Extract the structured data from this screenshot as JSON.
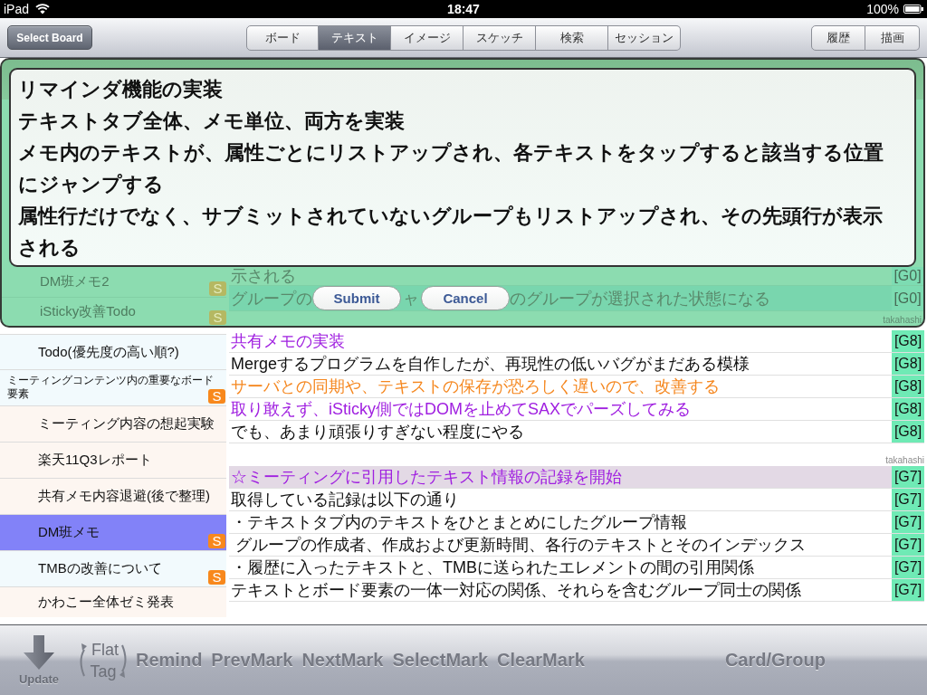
{
  "status_bar": {
    "device": "iPad",
    "time": "18:47",
    "battery": "100%"
  },
  "nav_bar": {
    "select_button": "Select Board",
    "tabs": [
      {
        "label": "ボード",
        "selected": false
      },
      {
        "label": "テキスト",
        "selected": true
      },
      {
        "label": "イメージ",
        "selected": false
      },
      {
        "label": "スケッチ",
        "selected": false
      },
      {
        "label": "検索",
        "selected": false
      },
      {
        "label": "セッション",
        "selected": false
      }
    ],
    "right_buttons": [
      "履歴",
      "描画"
    ]
  },
  "editor": {
    "paragraphs": [
      "リマインダ機能の実装",
      "テキストタブ全体、メモ単位、両方を実装",
      "メモ内のテキストが、属性ごとにリストアップされ、各テキストをタップすると該当する位置にジャンプする",
      "属性行だけでなく、サブミットされていないグループもリストアップされ、その先頭行が表示される"
    ],
    "buttons": [
      "Submit",
      "Cancel"
    ]
  },
  "dimmed_notes": [
    {
      "title": "DM班メモ2",
      "badge": "S"
    },
    {
      "title": "iSticky改善Todo",
      "badge": "S"
    }
  ],
  "dimmed_rows": [
    {
      "kind": "plain",
      "parts": [
        "示される"
      ],
      "tag": "[G0]",
      "highlighted": false
    },
    {
      "kind": "buttons",
      "parts": [
        "グループの",
        "ャ",
        "のグループが選択された状態になる"
      ],
      "tag": "[G0]",
      "highlighted": true
    }
  ],
  "notes": [
    {
      "title": "Todo(優先度の高い順?)",
      "kind": "normal",
      "color": "#f2fafd",
      "selected": false
    },
    {
      "title": "ミーティングコンテンツ内の重要なボード要素",
      "kind": "compact",
      "color": "#f2fafd",
      "badge": "S",
      "selected": false
    },
    {
      "title": "ミーティング内容の想起実験",
      "kind": "normal",
      "color": "#fdf6f1",
      "selected": false
    },
    {
      "title": "楽天11Q3レポート",
      "kind": "normal",
      "color": "#fdf6f1",
      "selected": false
    },
    {
      "title": "共有メモ内容退避(後で整理)",
      "kind": "normal",
      "color": "#fdf6f1",
      "selected": false
    },
    {
      "title": "DM班メモ",
      "kind": "normal",
      "badge": "S",
      "selected": true
    },
    {
      "title": "TMBの改善について",
      "kind": "normal",
      "color": "#f2fafd",
      "badge": "S",
      "selected": false
    },
    {
      "title": "かわこー全体ゼミ発表",
      "kind": "normal",
      "color": "#fdf6f1",
      "selected": false
    }
  ],
  "memo": {
    "groups": [
      {
        "author": "takahashi",
        "rows": [
          {
            "text": "共有メモの実装",
            "color": "#a020e0",
            "tag": "[G8]",
            "marked": false
          },
          {
            "text": "Mergeするプログラムを自作したが、再現性の低いバグがまだある模様",
            "color": "#111111",
            "tag": "[G8]",
            "marked": false
          },
          {
            "text": "サーバとの同期や、テキストの保存が恐ろしく遅いので、改善する",
            "color": "#f5871f",
            "tag": "[G8]",
            "marked": false
          },
          {
            "text": "取り敢えず、iSticky側ではDOMを止めてSAXでパーズしてみる",
            "color": "#a020e0",
            "tag": "[G8]",
            "marked": false
          },
          {
            "text": "でも、あまり頑張りすぎない程度にやる",
            "color": "#111111",
            "tag": "[G8]",
            "marked": false
          }
        ]
      },
      {
        "author": "takahashi",
        "rows": [
          {
            "text": "☆ミーティングに引用したテキスト情報の記録を開始",
            "color": "#a020e0",
            "tag": "[G7]",
            "marked": true
          },
          {
            "text": "取得している記録は以下の通り",
            "color": "#111111",
            "tag": "[G7]",
            "marked": false
          },
          {
            "text": "・テキストタブ内のテキストをひとまとめにしたグループ情報",
            "color": "#111111",
            "tag": "[G7]",
            "marked": false
          },
          {
            "text": " グループの作成者、作成および更新時間、各行のテキストとそのインデックス",
            "color": "#111111",
            "tag": "[G7]",
            "marked": false
          },
          {
            "text": "・履歴に入ったテキストと、TMBに送られたエレメントの間の引用関係",
            "color": "#111111",
            "tag": "[G7]",
            "marked": false
          },
          {
            "text": "テキストとボード要素の一体一対応の関係、それらを含むグループ同士の関係",
            "color": "#111111",
            "tag": "[G7]",
            "marked": false
          }
        ]
      }
    ]
  },
  "toolbar": {
    "update": "Update",
    "toggle": [
      "Flat",
      "Tag"
    ],
    "buttons": [
      "Remind",
      "PrevMark",
      "NextMark",
      "SelectMark",
      "ClearMark"
    ],
    "mode_button": "Card/Group"
  }
}
